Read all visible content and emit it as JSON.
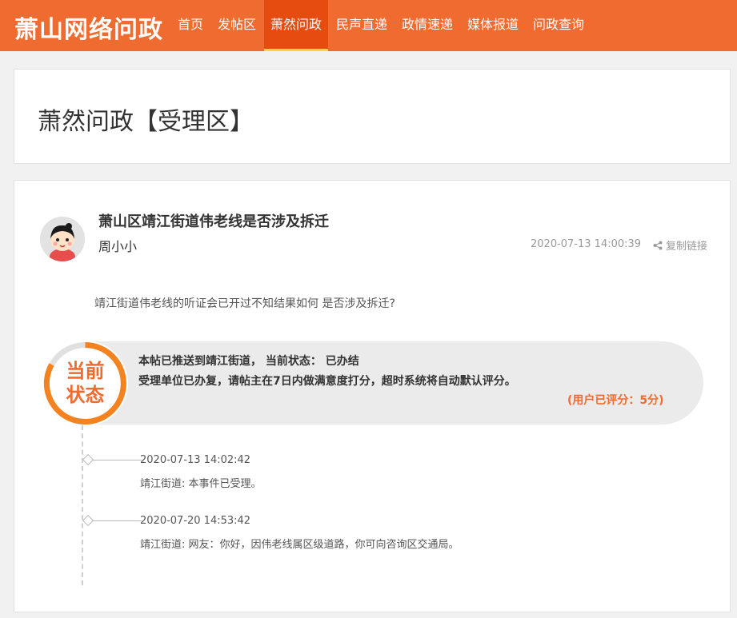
{
  "site": {
    "logo": "萧山网络问政"
  },
  "nav": {
    "items": [
      {
        "label": "首页"
      },
      {
        "label": "发帖区"
      },
      {
        "label": "萧然问政"
      },
      {
        "label": "民声直递"
      },
      {
        "label": "政情速递"
      },
      {
        "label": "媒体报道"
      },
      {
        "label": "问政查询"
      }
    ],
    "active_index": 2
  },
  "section": {
    "title": "萧然问政【受理区】"
  },
  "post": {
    "title": "萧山区靖江街道伟老线是否涉及拆迁",
    "author": "周小小",
    "time": "2020-07-13 14:00:39",
    "copy_link": "复制链接",
    "body": "靖江街道伟老线的听证会已开过不知结果如何 是否涉及拆迁?"
  },
  "status": {
    "badge_line1": "当前",
    "badge_line2": "状态",
    "line1": "本帖已推送到靖江街道， 当前状态： 已办结",
    "line2": "受理单位已办复，请帖主在7日内做满意度打分，超时系统将自动默认评分。",
    "rating": "(用户已评分：5分)"
  },
  "timeline": [
    {
      "time": "2020-07-13 14:02:42",
      "text": "靖江街道: 本事件已受理。"
    },
    {
      "time": "2020-07-20 14:53:42",
      "text": "靖江街道: 网友：你好，因伟老线属区级道路，你可向咨询区交通局。"
    }
  ],
  "colors": {
    "brand": "#f06b2f",
    "nav_active": "#e64b0f",
    "nav_active_underline": "#ffd24d"
  }
}
